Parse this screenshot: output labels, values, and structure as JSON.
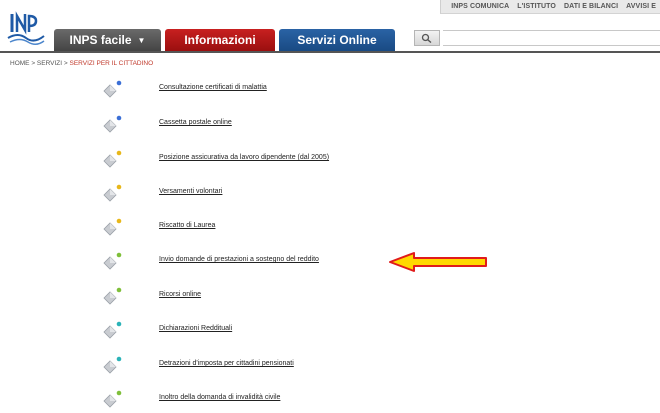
{
  "header": {
    "top_links": [
      "INPS COMUNICA",
      "L'ISTITUTO",
      "DATI E BILANCI",
      "AVVISI E"
    ],
    "menu": [
      {
        "label": "INPS facile",
        "caret": "▼"
      },
      {
        "label": "Informazioni"
      },
      {
        "label": "Servizi Online"
      }
    ]
  },
  "breadcrumb": {
    "items": [
      "HOME",
      "SERVIZI"
    ],
    "separator": ">",
    "current": "SERVIZI PER IL CITTADINO"
  },
  "services": [
    {
      "label": "Consultazione certificati di malattia",
      "color": "#3b6fd6"
    },
    {
      "label": "Cassetta postale online",
      "color": "#3b6fd6"
    },
    {
      "label": "Posizione assicurativa da lavoro dipendente (dal 2005)",
      "color": "#e8b71a"
    },
    {
      "label": "Versamenti volontari",
      "color": "#e8b71a"
    },
    {
      "label": "Riscatto di Laurea",
      "color": "#e8b71a"
    },
    {
      "label": "Invio domande di prestazioni a sostegno del reddito",
      "color": "#7fbf3a"
    },
    {
      "label": "Ricorsi online",
      "color": "#7fbf3a"
    },
    {
      "label": "Dichiarazioni Reddituali",
      "color": "#2bb3b8"
    },
    {
      "label": "Detrazioni d'imposta per cittadini pensionati",
      "color": "#2bb3b8"
    },
    {
      "label": "Inoltro della domanda di invalidità civile",
      "color": "#7fbf3a"
    }
  ],
  "colors": {
    "inps_facile": "#555555",
    "informazioni": "#b51717",
    "servizi_online": "#215696",
    "arrow_fill": "#ffd800",
    "arrow_outline": "#e01b1b"
  }
}
